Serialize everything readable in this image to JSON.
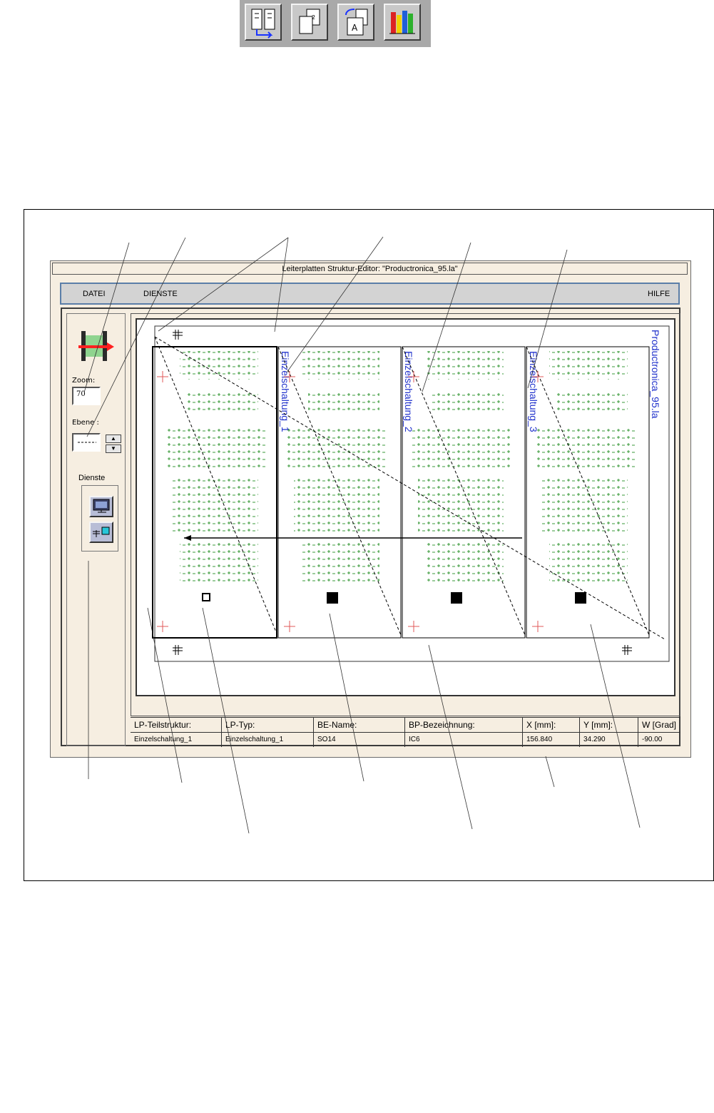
{
  "toolbar": {
    "buttons": [
      {
        "icon": "structure-compare-icon"
      },
      {
        "icon": "page-layers-icon"
      },
      {
        "icon": "text-rotate-icon"
      },
      {
        "icon": "books-library-icon"
      }
    ]
  },
  "window": {
    "title": "Leiterplatten Struktur-Editor: \"Productronica_95.la\"",
    "menu": {
      "datei": "DATEI",
      "dienste": "DIENSTE",
      "hilfe": "HILFE"
    }
  },
  "left_panel": {
    "mode_icon": "insert-arrow-icon",
    "zoom_label": "Zoom:",
    "zoom_value": "70",
    "layer_label": "Ebene :",
    "services_label": "Dienste",
    "service_icons": [
      "monitor-service-icon",
      "connect-service-icon"
    ]
  },
  "board": {
    "labels": [
      "Einzelschaltung_1",
      "Einzelschaltung_2",
      "Einzelschaltung_3",
      "Productronica_95.la"
    ]
  },
  "status": {
    "headers": [
      "LP-Teilstruktur:",
      "LP-Typ:",
      "BE-Name:",
      "BP-Bezeichnung:",
      "X [mm]:",
      "Y [mm]:",
      "W [Grad]"
    ],
    "values": [
      "Einzelschaltung_1",
      "Einzelschaltung_1",
      "SO14",
      "IC6",
      "156.840",
      "34.290",
      "-90.00"
    ]
  },
  "colors": {
    "accent": "#5b7ea8",
    "trace": "#3a9a3a",
    "label": "#2233cc",
    "crosshair": "#e05a5a"
  }
}
